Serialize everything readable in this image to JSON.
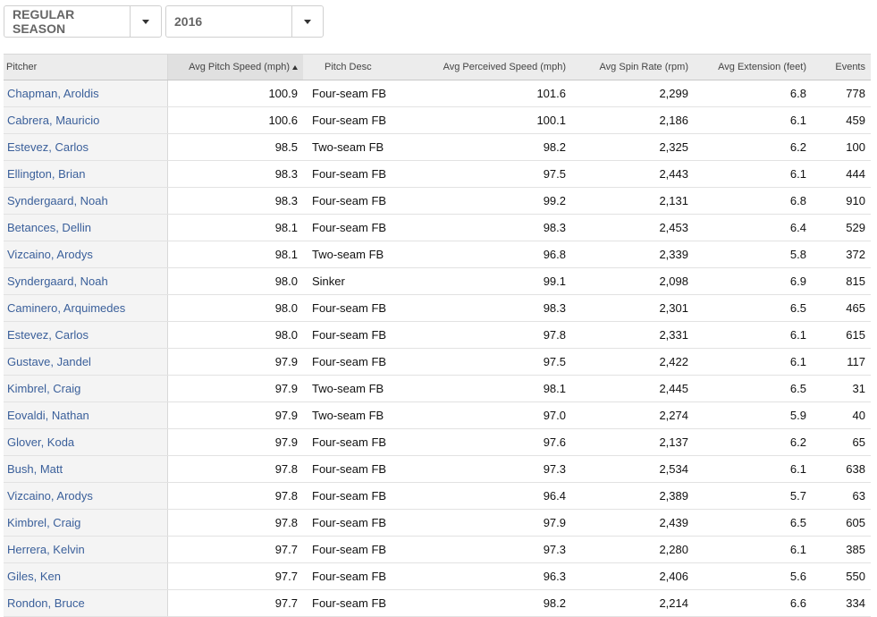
{
  "filters": {
    "season": "REGULAR SEASON",
    "year": "2016"
  },
  "icons": {
    "dropdown": "chevron-down-icon",
    "sort": "sort-ascending-icon"
  },
  "table": {
    "columns": {
      "pitcher": "Pitcher",
      "speed": "Avg Pitch Speed (mph)",
      "desc": "Pitch Desc",
      "perceived": "Avg Perceived Speed (mph)",
      "spin": "Avg Spin Rate (rpm)",
      "extension": "Avg Extension (feet)",
      "events": "Events"
    },
    "rows": [
      {
        "pitcher": "Chapman, Aroldis",
        "speed": "100.9",
        "desc": "Four-seam FB",
        "perceived": "101.6",
        "spin": "2,299",
        "extension": "6.8",
        "events": "778"
      },
      {
        "pitcher": "Cabrera, Mauricio",
        "speed": "100.6",
        "desc": "Four-seam FB",
        "perceived": "100.1",
        "spin": "2,186",
        "extension": "6.1",
        "events": "459"
      },
      {
        "pitcher": "Estevez, Carlos",
        "speed": "98.5",
        "desc": "Two-seam FB",
        "perceived": "98.2",
        "spin": "2,325",
        "extension": "6.2",
        "events": "100"
      },
      {
        "pitcher": "Ellington, Brian",
        "speed": "98.3",
        "desc": "Four-seam FB",
        "perceived": "97.5",
        "spin": "2,443",
        "extension": "6.1",
        "events": "444"
      },
      {
        "pitcher": "Syndergaard, Noah",
        "speed": "98.3",
        "desc": "Four-seam FB",
        "perceived": "99.2",
        "spin": "2,131",
        "extension": "6.8",
        "events": "910"
      },
      {
        "pitcher": "Betances, Dellin",
        "speed": "98.1",
        "desc": "Four-seam FB",
        "perceived": "98.3",
        "spin": "2,453",
        "extension": "6.4",
        "events": "529"
      },
      {
        "pitcher": "Vizcaino, Arodys",
        "speed": "98.1",
        "desc": "Two-seam FB",
        "perceived": "96.8",
        "spin": "2,339",
        "extension": "5.8",
        "events": "372"
      },
      {
        "pitcher": "Syndergaard, Noah",
        "speed": "98.0",
        "desc": "Sinker",
        "perceived": "99.1",
        "spin": "2,098",
        "extension": "6.9",
        "events": "815"
      },
      {
        "pitcher": "Caminero, Arquimedes",
        "speed": "98.0",
        "desc": "Four-seam FB",
        "perceived": "98.3",
        "spin": "2,301",
        "extension": "6.5",
        "events": "465"
      },
      {
        "pitcher": "Estevez, Carlos",
        "speed": "98.0",
        "desc": "Four-seam FB",
        "perceived": "97.8",
        "spin": "2,331",
        "extension": "6.1",
        "events": "615"
      },
      {
        "pitcher": "Gustave, Jandel",
        "speed": "97.9",
        "desc": "Four-seam FB",
        "perceived": "97.5",
        "spin": "2,422",
        "extension": "6.1",
        "events": "117"
      },
      {
        "pitcher": "Kimbrel, Craig",
        "speed": "97.9",
        "desc": "Two-seam FB",
        "perceived": "98.1",
        "spin": "2,445",
        "extension": "6.5",
        "events": "31"
      },
      {
        "pitcher": "Eovaldi, Nathan",
        "speed": "97.9",
        "desc": "Two-seam FB",
        "perceived": "97.0",
        "spin": "2,274",
        "extension": "5.9",
        "events": "40"
      },
      {
        "pitcher": "Glover, Koda",
        "speed": "97.9",
        "desc": "Four-seam FB",
        "perceived": "97.6",
        "spin": "2,137",
        "extension": "6.2",
        "events": "65"
      },
      {
        "pitcher": "Bush, Matt",
        "speed": "97.8",
        "desc": "Four-seam FB",
        "perceived": "97.3",
        "spin": "2,534",
        "extension": "6.1",
        "events": "638"
      },
      {
        "pitcher": "Vizcaino, Arodys",
        "speed": "97.8",
        "desc": "Four-seam FB",
        "perceived": "96.4",
        "spin": "2,389",
        "extension": "5.7",
        "events": "63"
      },
      {
        "pitcher": "Kimbrel, Craig",
        "speed": "97.8",
        "desc": "Four-seam FB",
        "perceived": "97.9",
        "spin": "2,439",
        "extension": "6.5",
        "events": "605"
      },
      {
        "pitcher": "Herrera, Kelvin",
        "speed": "97.7",
        "desc": "Four-seam FB",
        "perceived": "97.3",
        "spin": "2,280",
        "extension": "6.1",
        "events": "385"
      },
      {
        "pitcher": "Giles, Ken",
        "speed": "97.7",
        "desc": "Four-seam FB",
        "perceived": "96.3",
        "spin": "2,406",
        "extension": "5.6",
        "events": "550"
      },
      {
        "pitcher": "Rondon, Bruce",
        "speed": "97.7",
        "desc": "Four-seam FB",
        "perceived": "98.2",
        "spin": "2,214",
        "extension": "6.6",
        "events": "334"
      }
    ]
  }
}
